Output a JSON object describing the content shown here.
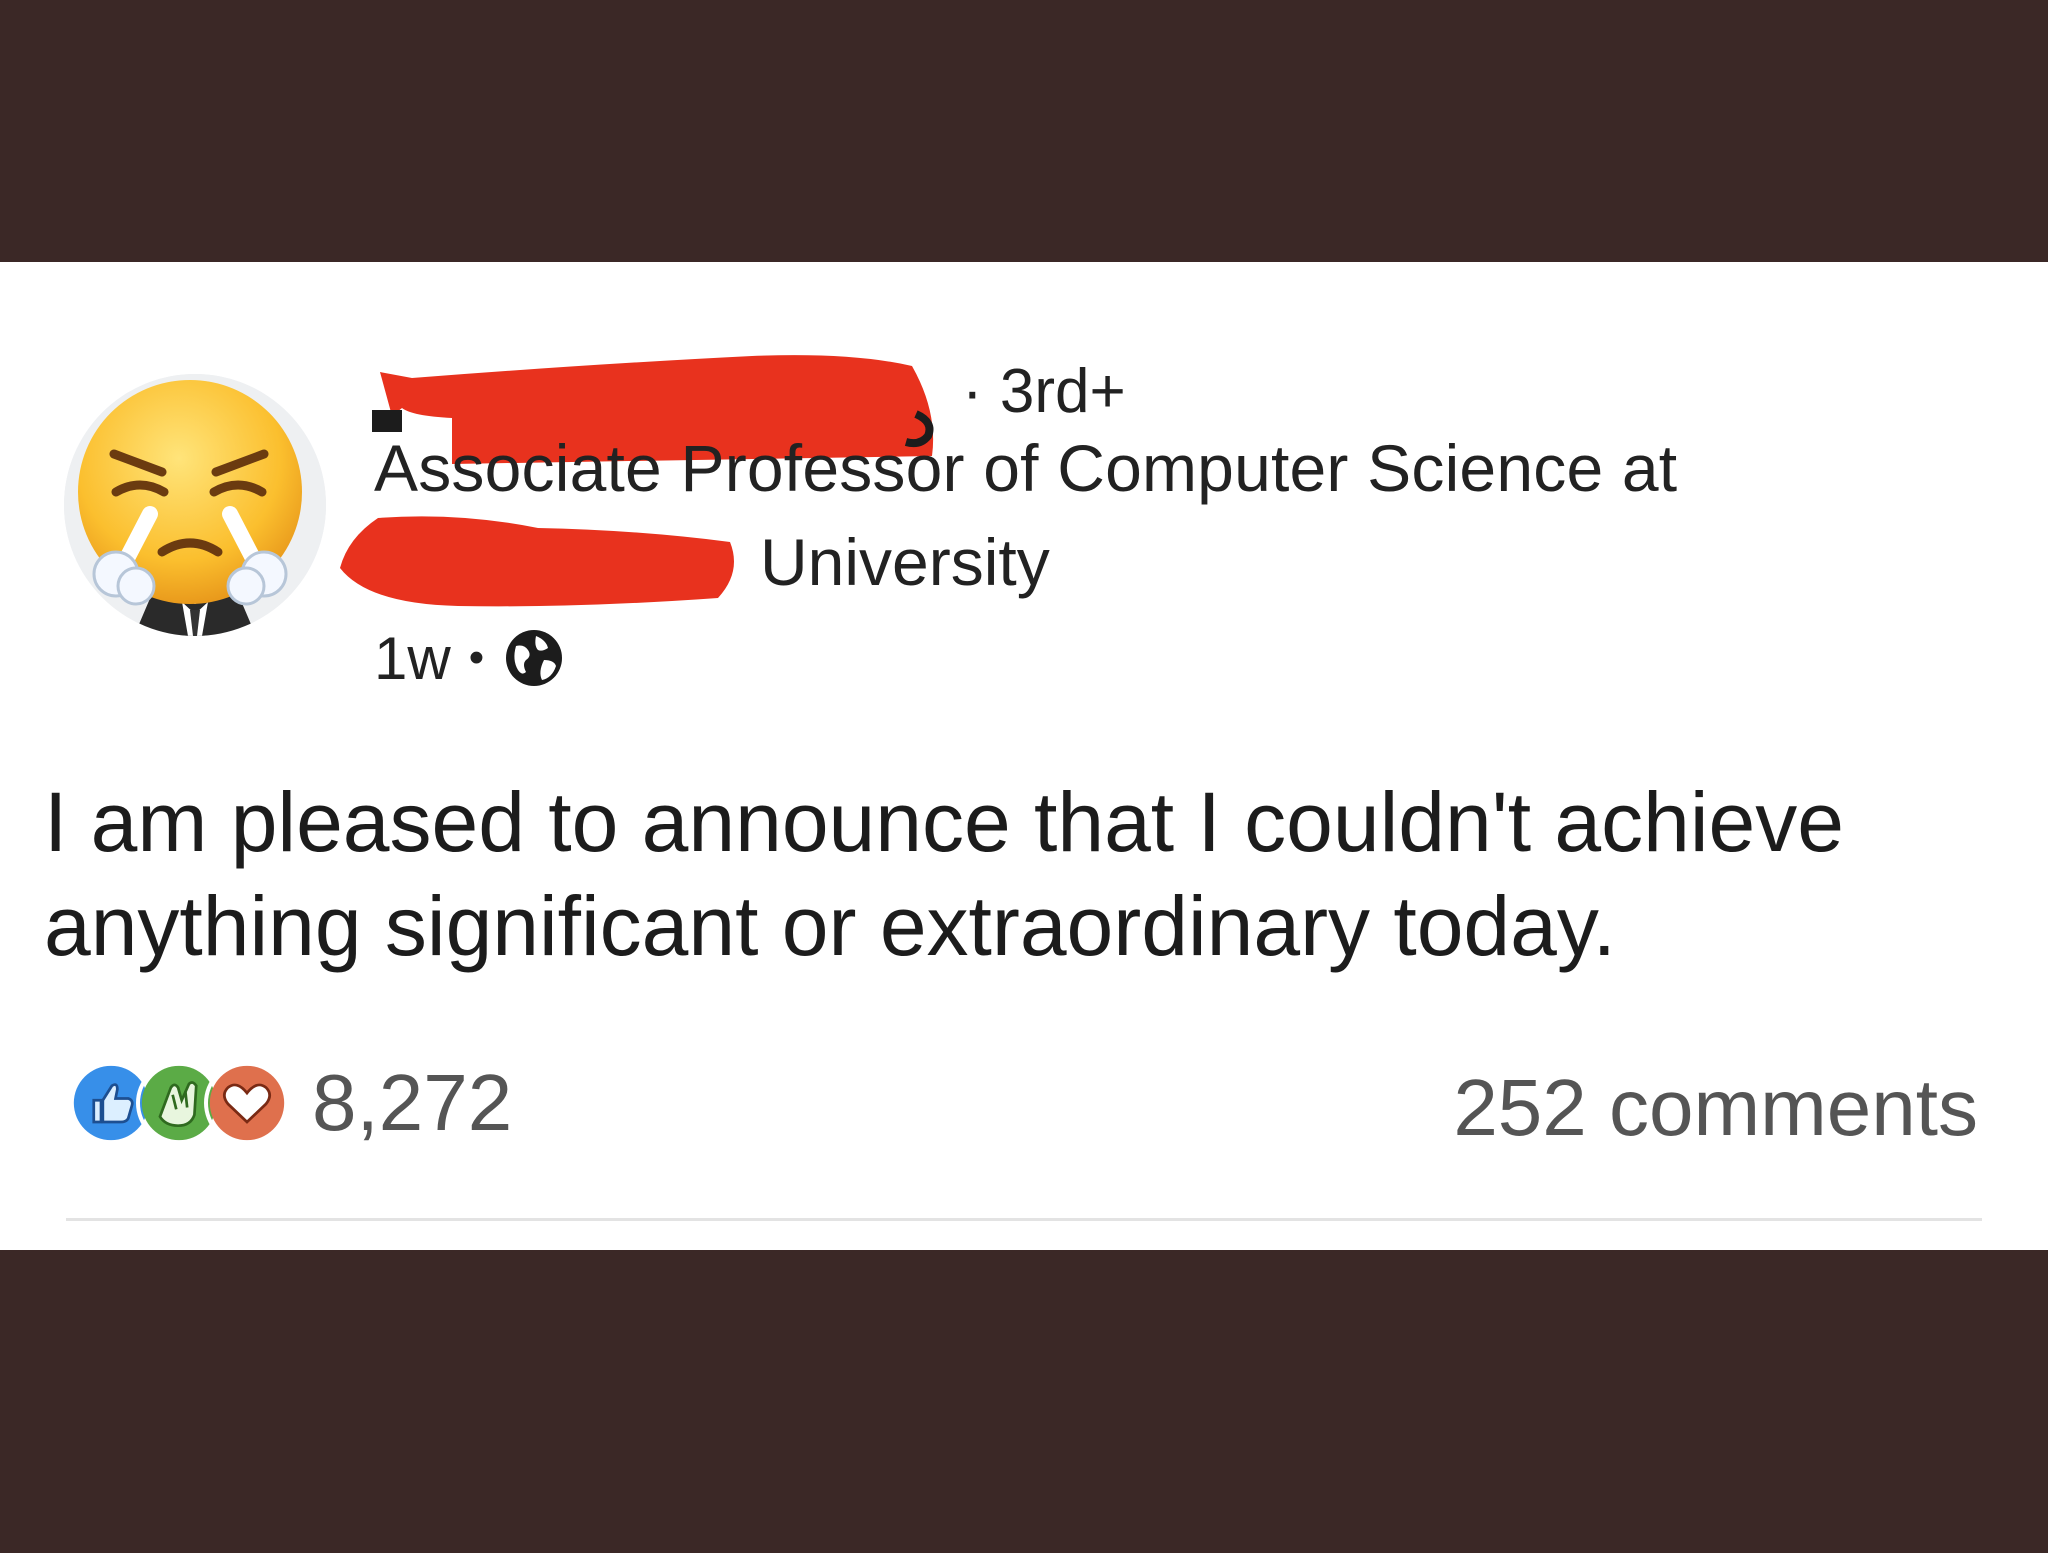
{
  "post": {
    "author": {
      "connection_degree": "· 3rd+",
      "headline_line1": "Associate Professor of Computer Science at",
      "headline_line2": "University",
      "avatar_icon": "face-with-steam-from-nose-emoji"
    },
    "meta": {
      "time_ago": "1w",
      "separator": "•",
      "visibility_icon": "globe-icon"
    },
    "body_text": "I am pleased to announce that I couldn't achieve anything significant or extraordinary today.",
    "social": {
      "reaction_icons": [
        "like-icon",
        "celebrate-icon",
        "love-icon"
      ],
      "reaction_count": "8,272",
      "comments": "252 comments"
    },
    "redaction_color": "#e8321e"
  },
  "colors": {
    "background_band": "#3b2826",
    "card": "#ffffff",
    "like": "#378fe9",
    "celebrate": "#5bab46",
    "love": "#df704d"
  }
}
